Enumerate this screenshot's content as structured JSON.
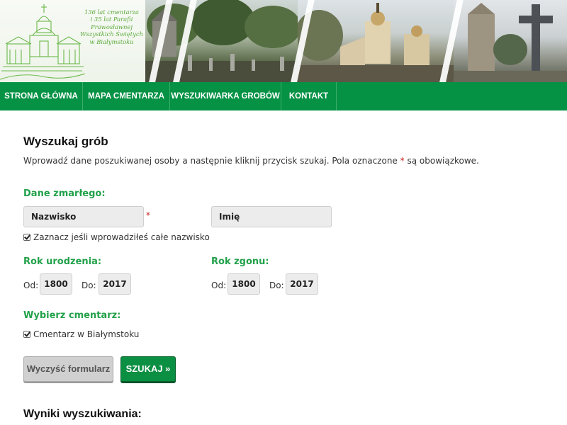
{
  "header": {
    "logo_lines": [
      "136 lat cmentarza",
      "i 35 lat Parafii",
      "Prawosławnej",
      "Wszystkich Świętych",
      "w Białymstoku"
    ]
  },
  "nav": {
    "items": [
      "STRONA GŁÓWNA",
      "MAPA CMENTARZA",
      "WYSZUKIWARKA GROBÓW",
      "KONTAKT"
    ]
  },
  "form": {
    "title": "Wyszukaj grób",
    "intro_before": "Wprowadź dane poszukiwanej osoby a następnie kliknij przycisk szukaj. Pola oznaczone",
    "intro_star": "*",
    "intro_after": "są obowiązkowe.",
    "deceased_label": "Dane zmarłego:",
    "surname_value": "Nazwisko",
    "required_star": "*",
    "firstname_value": "Imię",
    "full_surname_check": "Zaznacz jeśli wprowadziłeś całe nazwisko",
    "birth_label": "Rok urodzenia:",
    "death_label": "Rok zgonu:",
    "from_label": "Od:",
    "to_label": "Do:",
    "birth_from": "1800",
    "birth_to": "2017",
    "death_from": "1800",
    "death_to": "2017",
    "cemetery_label": "Wybierz cmentarz:",
    "cemetery_option": "Cmentarz w Białymstoku",
    "clear_button": "Wyczyść formularz",
    "search_button": "SZUKAJ »"
  },
  "results": {
    "title": "Wyniki wyszukiwania:"
  },
  "colors": {
    "nav_green": "#069245",
    "label_green": "#22a14a",
    "required_red": "#cc2222"
  }
}
